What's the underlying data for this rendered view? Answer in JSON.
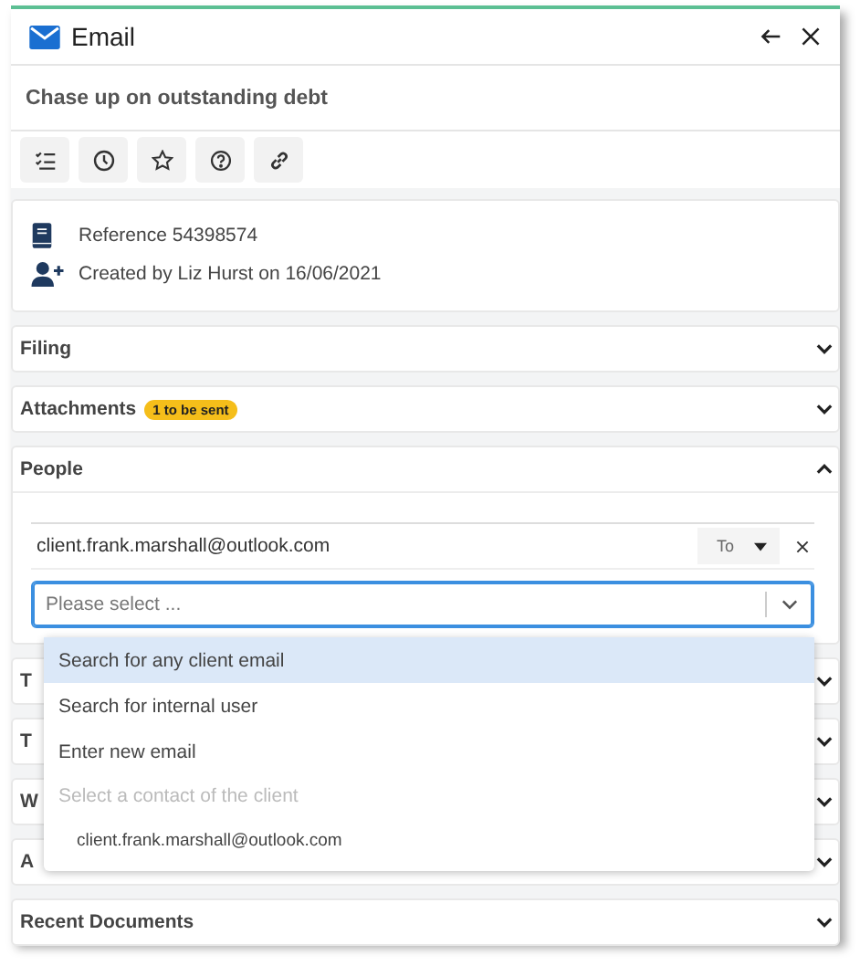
{
  "header": {
    "title": "Email"
  },
  "subject": "Chase up on outstanding debt",
  "toolbar": [
    {
      "kind": "checklist"
    },
    {
      "kind": "clock"
    },
    {
      "kind": "star"
    },
    {
      "kind": "help"
    },
    {
      "kind": "link"
    }
  ],
  "info": [
    {
      "kind": "book",
      "text": "Reference 54398574"
    },
    {
      "kind": "person-add",
      "text": "Created by Liz Hurst on 16/06/2021"
    }
  ],
  "sections": [
    {
      "title": "Filing",
      "expanded": false
    },
    {
      "title": "Attachments",
      "badge": "1 to be sent",
      "expanded": false
    },
    {
      "title": "People",
      "expanded": true
    },
    {
      "title": "T",
      "expanded": false
    },
    {
      "title": "T",
      "expanded": false
    },
    {
      "title": "W",
      "expanded": false
    },
    {
      "title": "A",
      "expanded": false
    },
    {
      "title": "Recent Documents",
      "expanded": false
    }
  ],
  "people": {
    "recipients": [
      {
        "email": "client.frank.marshall@outlook.com",
        "type": "To"
      }
    ],
    "select": {
      "placeholder": "Please select ...",
      "open": true
    },
    "options": [
      {
        "kind": "option",
        "label": "Search for any client email",
        "selected": true
      },
      {
        "kind": "option",
        "label": "Search for internal user",
        "selected": false
      },
      {
        "kind": "option",
        "label": "Enter new email",
        "selected": false
      },
      {
        "kind": "group",
        "label": "Select a contact of the client"
      },
      {
        "kind": "contact",
        "label": "client.frank.marshall@outlook.com",
        "selected": false
      }
    ]
  }
}
